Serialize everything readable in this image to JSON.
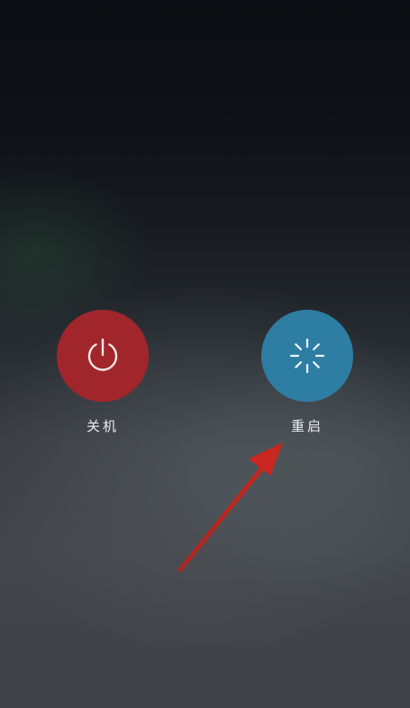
{
  "power_menu": {
    "shutdown": {
      "label": "关机",
      "icon": "power-icon",
      "color": "#a0262b"
    },
    "restart": {
      "label": "重启",
      "icon": "loading-spinner-icon",
      "color": "#2e7da3"
    }
  },
  "annotation": {
    "arrow_color": "#b9231c",
    "points_to": "restart"
  }
}
